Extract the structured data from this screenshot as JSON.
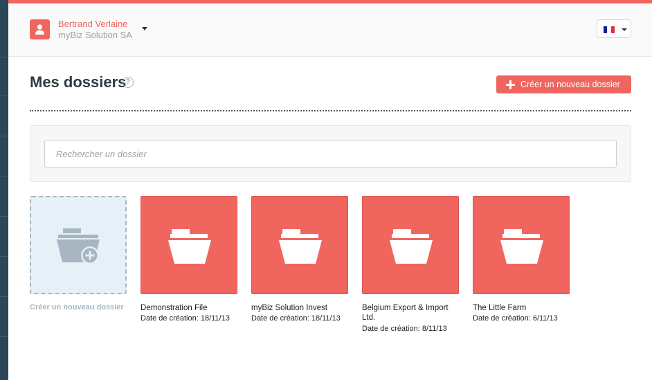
{
  "colors": {
    "accent": "#f0665f",
    "sidebar": "#2b4656",
    "muted": "#9aa3a8"
  },
  "header": {
    "user_name": "Bertrand Verlaine",
    "company": "myBiz Solution SA",
    "user_icon": "user-icon",
    "language_flag": "france-flag-icon",
    "flag_colors": [
      "#002395",
      "#ffffff",
      "#ed2939"
    ]
  },
  "page": {
    "title": "Mes dossiers",
    "help_glyph": "?",
    "create_button_label": "Créer un nouveau dossier"
  },
  "search": {
    "placeholder": "Rechercher un dossier",
    "value": ""
  },
  "new_folder_tile": {
    "label": "Créer un nouveau dossier",
    "icon": "add-folder-icon"
  },
  "folders": [
    {
      "name": "Demonstration File",
      "date": "Date de création: 18/11/13"
    },
    {
      "name": "myBiz Solution Invest",
      "date": "Date de création: 18/11/13"
    },
    {
      "name": "Belgium Export & Import Ltd.",
      "date": "Date de création: 8/11/13"
    },
    {
      "name": "The Little Farm",
      "date": "Date de création: 6/11/13"
    }
  ]
}
